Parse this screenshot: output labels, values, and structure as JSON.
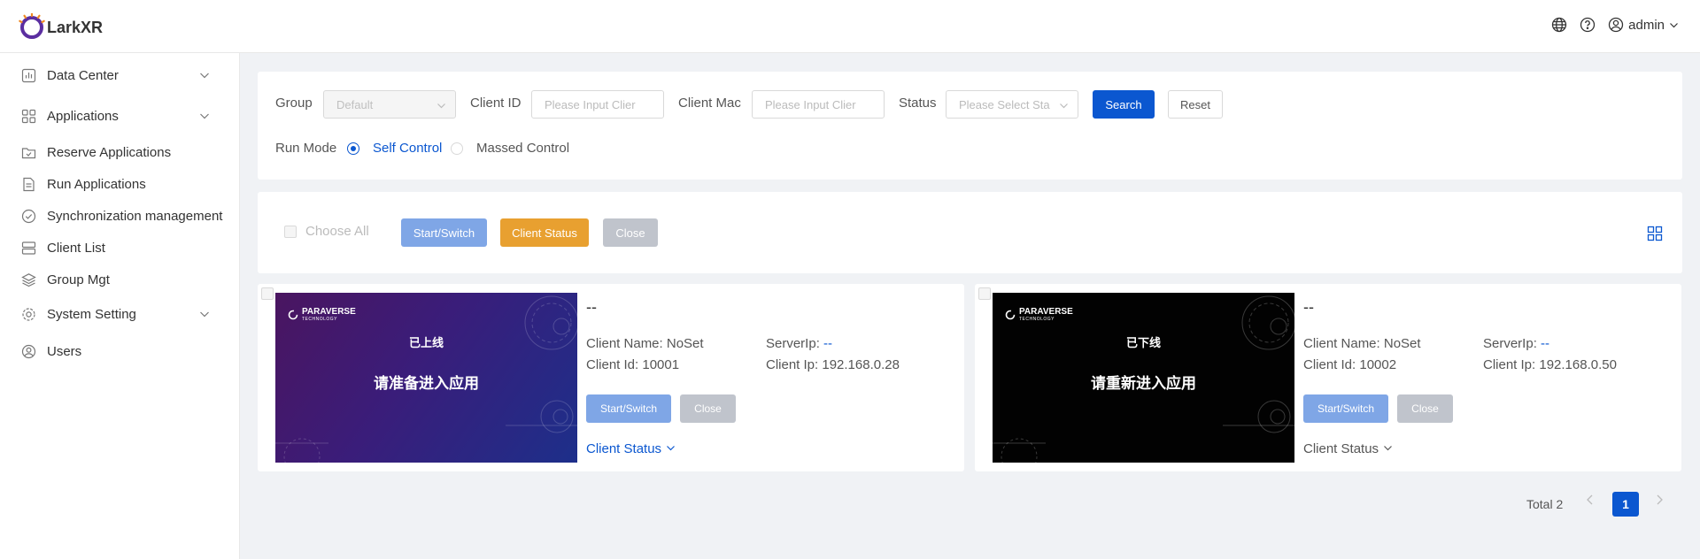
{
  "app": {
    "name": "LarkXR"
  },
  "header": {
    "icons": [
      "globe-icon",
      "help-icon",
      "user-icon"
    ],
    "user_name": "admin"
  },
  "sidebar": {
    "items": [
      {
        "label": "Data Center",
        "icon": "chart-icon",
        "expandable": true
      },
      {
        "label": "Applications",
        "icon": "apps-icon",
        "expandable": true
      },
      {
        "label": "Reserve Applications",
        "icon": "folder-icon",
        "expandable": false
      },
      {
        "label": "Run Applications",
        "icon": "document-icon",
        "expandable": false
      },
      {
        "label": "Synchronization management",
        "icon": "check-circle-icon",
        "expandable": false
      },
      {
        "label": "Client List",
        "icon": "server-icon",
        "expandable": false
      },
      {
        "label": "Group Mgt",
        "icon": "layers-icon",
        "expandable": false
      },
      {
        "label": "System Setting",
        "icon": "gear-icon",
        "expandable": true
      },
      {
        "label": "Users",
        "icon": "user-icon",
        "expandable": false
      }
    ]
  },
  "filter": {
    "group_label": "Group",
    "group_value": "Default",
    "client_id_label": "Client ID",
    "client_id_placeholder": "Please Input Clier",
    "client_mac_label": "Client Mac",
    "client_mac_placeholder": "Please Input Clier",
    "status_label": "Status",
    "status_placeholder": "Please Select Sta",
    "search_label": "Search",
    "reset_label": "Reset",
    "run_mode_label": "Run Mode",
    "run_mode_options": [
      "Self Control",
      "Massed Control"
    ],
    "run_mode_selected": "Self Control"
  },
  "actions": {
    "choose_all_label": "Choose All",
    "start_label": "Start/Switch",
    "status_label": "Client Status",
    "close_label": "Close"
  },
  "clients": [
    {
      "title": "--",
      "screen_line1": "已上线",
      "screen_line2": "请准备进入应用",
      "brand": "PARAVERSE",
      "brand_sub": "TECHNOLOGY",
      "name_label": "Client Name: NoSet",
      "server_label": "ServerIp:",
      "server_value": "--",
      "id_label": "Client Id: 10001",
      "ip_label": "Client Ip: 192.168.0.28",
      "start_label": "Start/Switch",
      "close_label": "Close",
      "status_label": "Client Status",
      "status_color": "#0b57d0"
    },
    {
      "title": "--",
      "screen_line1": "已下线",
      "screen_line2": "请重新进入应用",
      "brand": "PARAVERSE",
      "brand_sub": "TECHNOLOGY",
      "name_label": "Client Name: NoSet",
      "server_label": "ServerIp:",
      "server_value": "--",
      "id_label": "Client Id: 10002",
      "ip_label": "Client Ip: 192.168.0.50",
      "start_label": "Start/Switch",
      "close_label": "Close",
      "status_label": "Client Status",
      "status_color": "#555555"
    }
  ],
  "pagination": {
    "total_label": "Total 2",
    "current_page": "1"
  },
  "colors": {
    "primary": "#0b57d0",
    "warning": "#e8a030",
    "disabled": "#c0c4cc"
  }
}
